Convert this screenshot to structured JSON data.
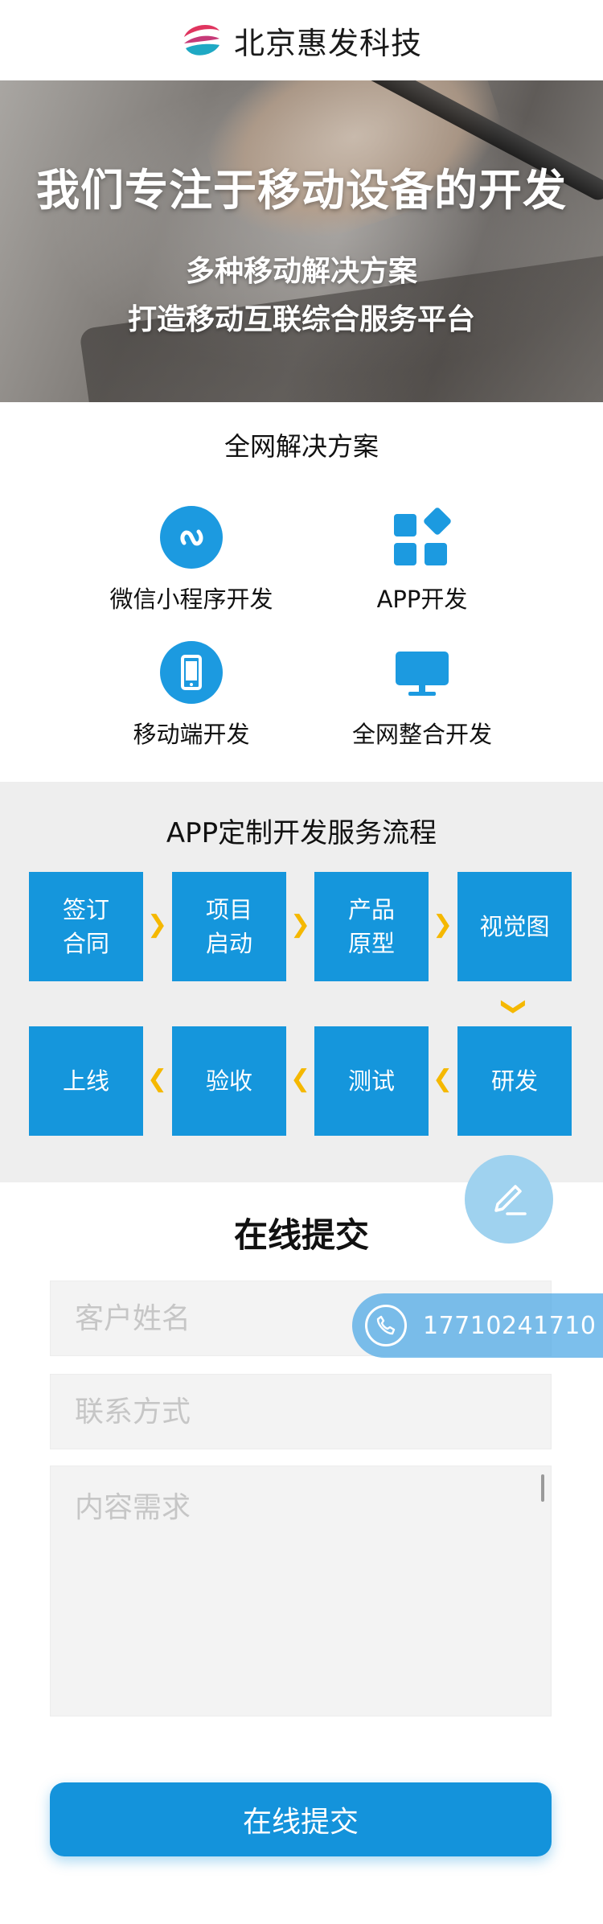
{
  "header": {
    "brand": "北京惠发科技"
  },
  "banner": {
    "headline": "我们专注于移动设备的开发",
    "line1": "多种移动解决方案",
    "line2": "打造移动互联综合服务平台"
  },
  "solutions": {
    "title": "全网解决方案",
    "items": [
      {
        "label": "微信小程序开发",
        "icon": "mini-program-icon"
      },
      {
        "label": "APP开发",
        "icon": "app-grid-icon"
      },
      {
        "label": "移动端开发",
        "icon": "mobile-phone-icon"
      },
      {
        "label": "全网整合开发",
        "icon": "monitor-icon"
      }
    ]
  },
  "process": {
    "title": "APP定制开发服务流程",
    "steps": [
      "签订\n合同",
      "项目\n启动",
      "产品\n原型",
      "视觉图",
      "研发",
      "测试",
      "验收",
      "上线"
    ]
  },
  "form": {
    "title": "在线提交",
    "name_placeholder": "客户姓名",
    "contact_placeholder": "联系方式",
    "content_placeholder": "内容需求",
    "submit_label": "在线提交"
  },
  "float": {
    "phone": "17710241710"
  },
  "colors": {
    "primary": "#1596dc",
    "arrow": "#f5b800",
    "panel": "#eeeeee"
  }
}
